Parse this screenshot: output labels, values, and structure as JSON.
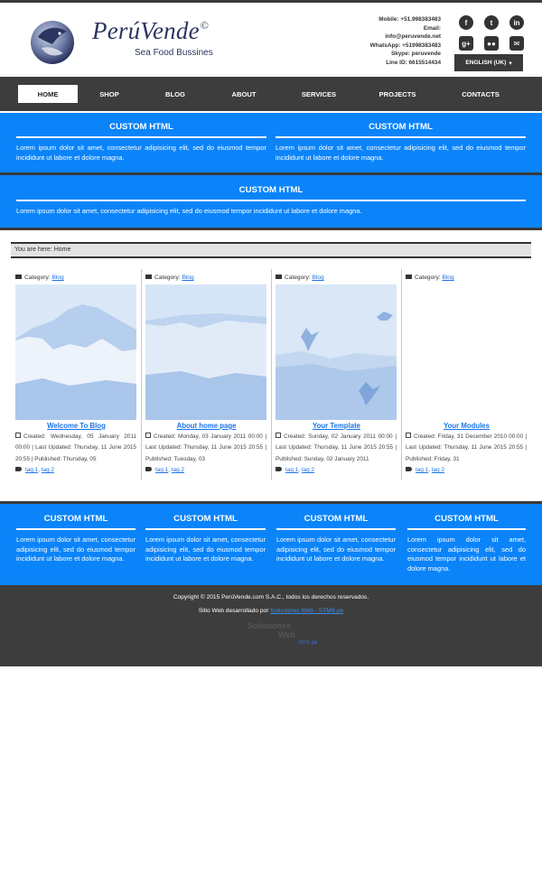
{
  "brand": {
    "name": "PerúVende",
    "registered_mark": "©",
    "tagline": "Sea Food Bussines"
  },
  "contact": {
    "lines": [
      "Mobile: +51.998383483",
      "Email:",
      "info@peruvende.net",
      "WhatsApp: +51998383483",
      "Skype: peruvende",
      "Line ID: 6615514434"
    ]
  },
  "social": [
    {
      "icon": "facebook-icon",
      "glyph": "f"
    },
    {
      "icon": "tumblr-icon",
      "glyph": "t"
    },
    {
      "icon": "linkedin-icon",
      "glyph": "in"
    },
    {
      "icon": "google-plus-icon",
      "glyph": "g+"
    },
    {
      "icon": "flickr-icon",
      "glyph": "●●"
    },
    {
      "icon": "email-icon",
      "glyph": "✉"
    }
  ],
  "language": {
    "label": "ENGLISH (UK)",
    "caret": "▾"
  },
  "nav": {
    "items": [
      "HOME",
      "SHOP",
      "BLOG",
      "ABOUT",
      "SERVICES",
      "PROJECTS",
      "CONTACTS"
    ],
    "active": "HOME"
  },
  "top_modules": [
    {
      "title": "CUSTOM HTML",
      "text": "Lorem ipsum dolor sit amet, consectetur adipisicing elit, sed do eiusmod tempor incididunt ut labore et dolore magna."
    },
    {
      "title": "CUSTOM HTML",
      "text": "Lorem ipsum dolor sit amet, consectetur adipisicing elit, sed do eiusmod tempor incididunt ut labore et dolore magna."
    }
  ],
  "wide_module": {
    "title": "CUSTOM HTML",
    "text": "Lorem ipsum dolor sit amet, consectetur adipisicing elit, sed do eiusmod tempor incididunt ut labore et dolore magna."
  },
  "breadcrumb": {
    "prefix": "You are here:",
    "current": "Home"
  },
  "articles": [
    {
      "category_label": "Category:",
      "category": "Blog",
      "title": "Welcome To Blog",
      "meta": "Created: Wednesday, 05 January 2011 00:00 | Last Updated: Thursday, 11 June 2015 20:55 | Published: Thursday, 05",
      "tags": [
        "tag 1",
        "tag 2"
      ]
    },
    {
      "category_label": "Category:",
      "category": "Blog",
      "title": "About home page",
      "meta": "Created: Monday, 03 January 2011 00:00 | Last Updated: Thursday, 11 June 2015 20:55 | Published: Tuesday, 03",
      "tags": [
        "tag 1",
        "tag 2"
      ]
    },
    {
      "category_label": "Category:",
      "category": "Blog",
      "title": "Your Template",
      "meta": "Created: Sunday, 02 January 2011 00:00 | Last Updated: Thursday, 11 June 2015 20:55 | Published: Sunday, 02 January 2011",
      "tags": [
        "tag 1",
        "tag 2"
      ]
    },
    {
      "category_label": "Category:",
      "category": "Blog",
      "title": "Your Modules",
      "meta": "Created: Friday, 31 December 2010 00:00 | Last Updated: Thursday, 11 June 2015 20:55 | Published: Friday, 31",
      "tags": [
        "tag 1",
        "tag 2"
      ]
    }
  ],
  "bottom_modules": [
    {
      "title": "CUSTOM HTML",
      "text": "Lorem ipsum dolor sit amet, consectetur adipisicing elit, sed do eiusmod tempor incididunt ut labore et dolore magna."
    },
    {
      "title": "CUSTOM HTML",
      "text": "Lorem ipsum dolor sit amet, consectetur adipisicing elit, sed do eiusmod tempor incididunt ut labore et dolore magna."
    },
    {
      "title": "CUSTOM HTML",
      "text": "Lorem ipsum dolor sit amet, consectetur adipisicing elit, sed do eiusmod tempor incididunt ut labore et dolore magna."
    },
    {
      "title": "CUSTOM HTML",
      "text": "Lorem ipsum dolor sit amet, consectetur adipisicing elit, sed do eiusmod tempor incididunt ut labore et dolore magna."
    }
  ],
  "footer": {
    "copyright": "Copyright © 2015 PerúVende.com S.A.C., todos los derechos reservados.",
    "credit_prefix": "Sitio Web desarrollado por",
    "credit_link": "Soluciones Web - STMB.pe",
    "logo_line1": "Soluciones",
    "logo_line2": "Web",
    "logo_line3": "stmb.pe"
  },
  "colors": {
    "accent_blue": "#0b84fa",
    "dark_bar": "#3d3d3d",
    "link_blue": "#1a73e8"
  }
}
